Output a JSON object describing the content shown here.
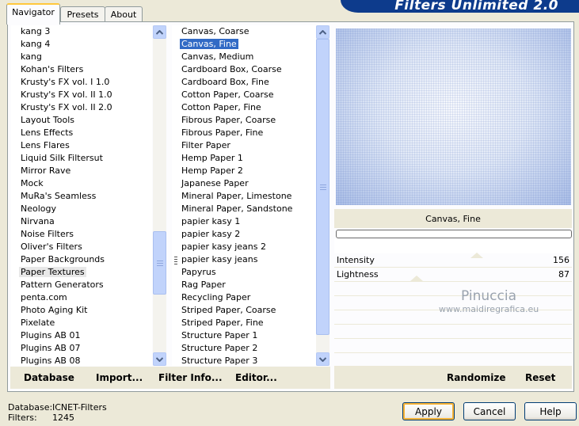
{
  "tabs": [
    "Navigator",
    "Presets",
    "About"
  ],
  "banner_title": "Filters Unlimited 2.0",
  "categories": [
    "kang 3",
    "kang 4",
    "kang",
    "Kohan's Filters",
    "Krusty's FX vol. I 1.0",
    "Krusty's FX vol. II 1.0",
    "Krusty's FX vol. II 2.0",
    "Layout Tools",
    "Lens Effects",
    "Lens Flares",
    "Liquid Silk Filtersut",
    "Mirror Rave",
    "Mock",
    "MuRa's Seamless",
    "Neology",
    "Nirvana",
    "Noise Filters",
    "Oliver's Filters",
    "Paper Backgrounds",
    "Paper Textures",
    "Pattern Generators",
    "penta.com",
    "Photo Aging Kit",
    "Pixelate",
    "Plugins AB 01",
    "Plugins AB 07",
    "Plugins AB 08"
  ],
  "selected_category": "Paper Textures",
  "filters": [
    "Canvas, Coarse",
    "Canvas, Fine",
    "Canvas, Medium",
    "Cardboard Box, Coarse",
    "Cardboard Box, Fine",
    "Cotton Paper, Coarse",
    "Cotton Paper, Fine",
    "Fibrous Paper, Coarse",
    "Fibrous Paper, Fine",
    "Filter Paper",
    "Hemp Paper 1",
    "Hemp Paper 2",
    "Japanese Paper",
    "Mineral Paper, Limestone",
    "Mineral Paper, Sandstone",
    "papier kasy 1",
    "papier kasy 2",
    "papier kasy jeans 2",
    "papier kasy jeans",
    "Papyrus",
    "Rag Paper",
    "Recycling Paper",
    "Striped Paper, Coarse",
    "Striped Paper, Fine",
    "Structure Paper 1",
    "Structure Paper 2",
    "Structure Paper 3"
  ],
  "selected_filter": "Canvas, Fine",
  "preview_filter_name": "Canvas, Fine",
  "params": [
    {
      "name": "Intensity",
      "value": "156"
    },
    {
      "name": "Lightness",
      "value": "87"
    }
  ],
  "watermark": {
    "line1": "Pinuccia",
    "line2": "www.maidiregrafica.eu"
  },
  "left_buttons": {
    "database": "Database",
    "import": "Import...",
    "filter_info": "Filter Info...",
    "editor": "Editor..."
  },
  "right_buttons": {
    "randomize": "Randomize",
    "reset": "Reset"
  },
  "status": {
    "database_label": "Database:",
    "database_value": "ICNET-Filters",
    "filters_label": "Filters:",
    "filters_value": "1245"
  },
  "dialog_buttons": {
    "apply": "Apply",
    "cancel": "Cancel",
    "help": "Help"
  },
  "colors": {
    "selection": "#316AC5",
    "banner": "#0D3B8C",
    "scroll": "#C1D3FB"
  }
}
